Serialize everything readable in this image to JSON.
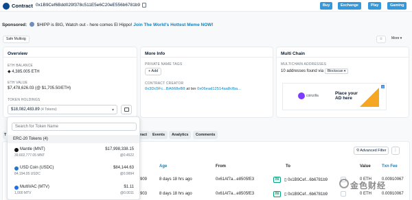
{
  "header": {
    "title": "Contract",
    "address": "0x1B9Cef6Bdd029f378c511E5e6C20eE556b6781b9",
    "buttons": [
      "Buy",
      "Exchange",
      "Play",
      "Gaming"
    ]
  },
  "sponsor": {
    "label": "Sponsored:",
    "text": "$HIPP is BIG, Watch out - here comes El Hippo!",
    "link": "Join The World's Hottest Meme NOW!"
  },
  "tags": {
    "multisig": "Safe Multisig",
    "more": "More"
  },
  "overview": {
    "title": "Overview",
    "eth_balance_label": "ETH BALANCE",
    "eth_balance": "4,385.005 ETH",
    "eth_value_label": "ETH VALUE",
    "eth_value": "$7,478,626.03 (@ $1,705.50/ETH)",
    "token_holdings_label": "TOKEN HOLDINGS",
    "token_holdings": "$18,082,483.89",
    "token_count": "(4 Tokens)"
  },
  "more_info": {
    "title": "More Info",
    "private_tags_label": "PRIVATE NAME TAGS",
    "add_label": "+ Add",
    "creator_label": "CONTRACT CREATOR",
    "creator_addr": "0x3Dc5Fc...BA668eB8",
    "creator_mid": "at txn",
    "creator_txn": "0x06ead12514aa8cfba..."
  },
  "multi_chain": {
    "title": "Multi Chain",
    "addresses_label": "MULTICHAIN ADDRESSES",
    "found_text": "10 addresses found via",
    "via": "Blockscan"
  },
  "ad": {
    "brand": "coinzilla",
    "line1": "Place your",
    "line2": "AD here"
  },
  "tabs": [
    "Transactions",
    "Contract",
    "Events",
    "Analytics",
    "Comments"
  ],
  "tabs_visible": [
    "ract",
    "Events",
    "Analytics",
    "Comments"
  ],
  "table": {
    "adv_filter": "Advanced Filter",
    "headers": {
      "age": "Age",
      "from": "From",
      "to": "To",
      "value": "Value",
      "txn_fee": "Txn Fee"
    },
    "rows": [
      {
        "block_tail": "909",
        "age": "8 days 18 hrs ago",
        "from": "0x61Af7a...e8505fE3",
        "dir": "IN",
        "to": "0x1B9Cef...6b6781b9",
        "value": "0 ETH",
        "fee": "0.00910067"
      },
      {
        "block_tail": "903",
        "age": "8 days 18 hrs ago",
        "from": "0x61Af7a...e8505fE3",
        "dir": "IN",
        "to": "0x1B9Cef...6b6781b9",
        "value": "0 ETH",
        "fee": "0.00910067"
      }
    ]
  },
  "token_dropdown": {
    "search_placeholder": "Search for Token Name",
    "section": "ERC-20 Tokens (4)",
    "tokens": [
      {
        "name": "Mantle (MNT)",
        "amount": "39,602,777.05 MNT",
        "value": "$17,998,338.15",
        "price": "@0.4522",
        "color": "#111111"
      },
      {
        "name": "USD Coin (USDC)",
        "amount": "84,194.05 USDC",
        "value": "$84,144.63",
        "price": "@0.9994",
        "color": "#2775ca"
      },
      {
        "name": "MultiVAC (MTV)",
        "amount": "1,000 MTV",
        "value": "$1.11",
        "price": "@0.0011",
        "color": "#1f6feb"
      }
    ]
  },
  "watermark": "金色财经"
}
